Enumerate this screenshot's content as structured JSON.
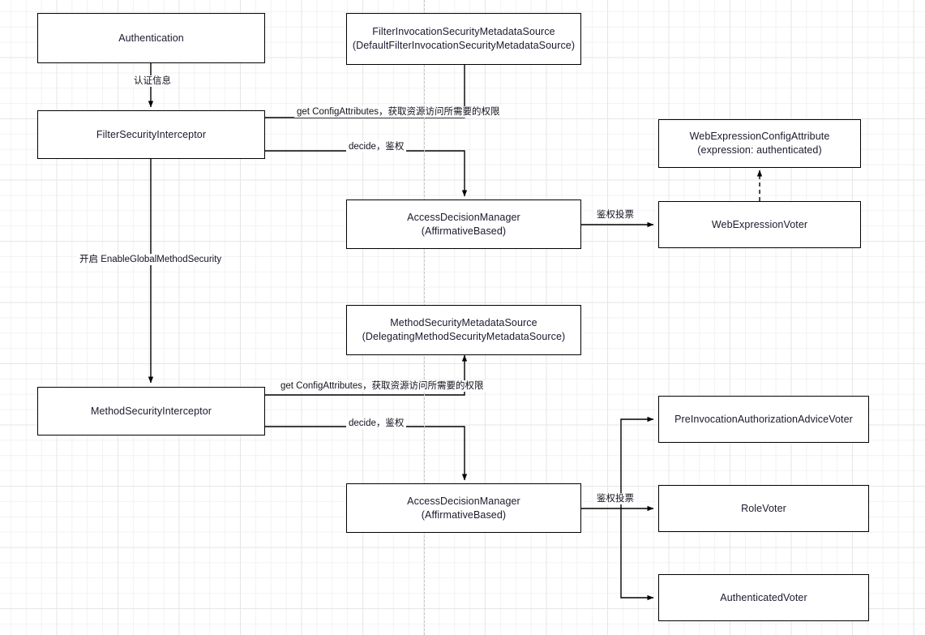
{
  "diagram": {
    "title": "Spring Security Authorization Flow",
    "background": {
      "grid_minor_color": "#f2f2f2",
      "grid_major_color": "#e6e6e6",
      "page_guide_color": "#c8c8c8",
      "canvas_color": "#ffffff"
    },
    "style": {
      "node_border_color": "#000000",
      "node_fill_color": "#ffffff",
      "text_color": "#1a1a2e",
      "connector_color": "#000000"
    },
    "nodes": [
      {
        "id": "authentication",
        "label": "Authentication"
      },
      {
        "id": "filter-metadata",
        "label": "FilterInvocationSecurityMetadataSource\n(DefaultFilterInvocationSecurityMetadataSource)"
      },
      {
        "id": "filter-interceptor",
        "label": "FilterSecurityInterceptor"
      },
      {
        "id": "web-config-attribute",
        "label": "WebExpressionConfigAttribute\n(expression: authenticated)"
      },
      {
        "id": "adm-web",
        "label": "AccessDecisionManager\n(AffirmativeBased)"
      },
      {
        "id": "web-expression-voter",
        "label": "WebExpressionVoter"
      },
      {
        "id": "method-metadata",
        "label": "MethodSecurityMetadataSource\n(DelegatingMethodSecurityMetadataSource)"
      },
      {
        "id": "method-interceptor",
        "label": "MethodSecurityInterceptor"
      },
      {
        "id": "pre-invocation-voter",
        "label": "PreInvocationAuthorizationAdviceVoter"
      },
      {
        "id": "adm-method",
        "label": "AccessDecisionManager\n(AffirmativeBased)"
      },
      {
        "id": "role-voter",
        "label": "RoleVoter"
      },
      {
        "id": "authenticated-voter",
        "label": "AuthenticatedVoter"
      }
    ],
    "edge_labels": [
      {
        "id": "auth-info",
        "text": "认证信息"
      },
      {
        "id": "get-config-web",
        "text": "get ConfigAttributes，获取资源访问所需要的权限"
      },
      {
        "id": "decide-web",
        "text": "decide，鉴权"
      },
      {
        "id": "vote-web",
        "text": "鉴权投票"
      },
      {
        "id": "enable-global",
        "text": "开启 EnableGlobalMethodSecurity"
      },
      {
        "id": "get-config-method",
        "text": "get ConfigAttributes，获取资源访问所需要的权限"
      },
      {
        "id": "decide-method",
        "text": "decide，鉴权"
      },
      {
        "id": "vote-method",
        "text": "鉴权投票"
      }
    ]
  }
}
